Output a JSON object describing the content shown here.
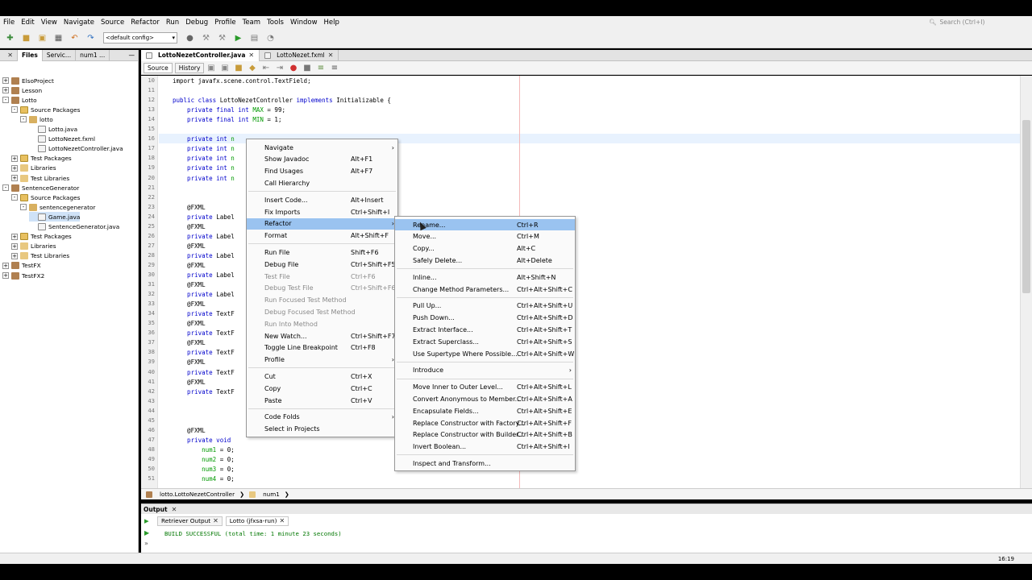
{
  "menubar": {
    "items": [
      "File",
      "Edit",
      "View",
      "Navigate",
      "Source",
      "Refactor",
      "Run",
      "Debug",
      "Profile",
      "Team",
      "Tools",
      "Window",
      "Help"
    ],
    "search_placeholder": "Search (Ctrl+I)"
  },
  "toolbar": {
    "config": "<default config>"
  },
  "left_panel": {
    "tabs": [
      "Files",
      "Servic...",
      "num1 ..."
    ],
    "tree": [
      {
        "label": "ElsoProject",
        "icon": "project-icon",
        "level": 0,
        "toggle": "+"
      },
      {
        "label": "Lesson",
        "icon": "project-icon",
        "level": 0,
        "toggle": "+"
      },
      {
        "label": "Lotto",
        "icon": "project-icon",
        "level": 0,
        "toggle": "-"
      },
      {
        "label": "Source Packages",
        "icon": "source-packages-icon",
        "level": 1,
        "toggle": "-"
      },
      {
        "label": "lotto",
        "icon": "package-icon",
        "level": 2,
        "toggle": "-"
      },
      {
        "label": "Lotto.java",
        "icon": "java-file-icon",
        "level": 3,
        "toggle": ""
      },
      {
        "label": "LottoNezet.fxml",
        "icon": "fxml-file-icon",
        "level": 3,
        "toggle": ""
      },
      {
        "label": "LottoNezetController.java",
        "icon": "java-file-icon",
        "level": 3,
        "toggle": ""
      },
      {
        "label": "Test Packages",
        "icon": "test-packages-icon",
        "level": 1,
        "toggle": "+"
      },
      {
        "label": "Libraries",
        "icon": "libraries-icon",
        "level": 1,
        "toggle": "+"
      },
      {
        "label": "Test Libraries",
        "icon": "libraries-icon",
        "level": 1,
        "toggle": "+"
      },
      {
        "label": "SentenceGenerator",
        "icon": "project-icon",
        "level": 0,
        "toggle": "-"
      },
      {
        "label": "Source Packages",
        "icon": "source-packages-icon",
        "level": 1,
        "toggle": "-"
      },
      {
        "label": "sentencegenerator",
        "icon": "package-icon",
        "level": 2,
        "toggle": "-"
      },
      {
        "label": "Game.java",
        "icon": "java-file-icon",
        "level": 3,
        "toggle": "",
        "selected": true
      },
      {
        "label": "SentenceGenerator.java",
        "icon": "java-file-icon",
        "level": 3,
        "toggle": ""
      },
      {
        "label": "Test Packages",
        "icon": "test-packages-icon",
        "level": 1,
        "toggle": "+"
      },
      {
        "label": "Libraries",
        "icon": "libraries-icon",
        "level": 1,
        "toggle": "+"
      },
      {
        "label": "Test Libraries",
        "icon": "libraries-icon",
        "level": 1,
        "toggle": "+"
      },
      {
        "label": "TestFX",
        "icon": "project-icon",
        "level": 0,
        "toggle": "+"
      },
      {
        "label": "TestFX2",
        "icon": "project-icon",
        "level": 0,
        "toggle": "+"
      }
    ]
  },
  "editor": {
    "tabs": [
      {
        "label": "LottoNezetController.java",
        "active": true
      },
      {
        "label": "LottoNezet.fxml",
        "active": false
      }
    ],
    "source_tab": "Source",
    "history_tab": "History",
    "lines": [
      {
        "n": "10",
        "parts": [
          [
            "import javafx.scene.control.TextField;",
            ""
          ]
        ]
      },
      {
        "n": "11",
        "parts": [
          [
            "",
            ""
          ]
        ]
      },
      {
        "n": "12",
        "parts": [
          [
            "public class ",
            "kw"
          ],
          [
            "LottoNezetController ",
            ""
          ],
          [
            "implements ",
            "kw"
          ],
          [
            "Initializable {",
            ""
          ]
        ]
      },
      {
        "n": "13",
        "parts": [
          [
            "    private final int ",
            "kw"
          ],
          [
            "MAX",
            "fld"
          ],
          [
            " = 99;",
            ""
          ]
        ]
      },
      {
        "n": "14",
        "parts": [
          [
            "    private final int ",
            "kw"
          ],
          [
            "MIN",
            "fld"
          ],
          [
            " = 1;",
            ""
          ]
        ]
      },
      {
        "n": "15",
        "parts": [
          [
            "",
            ""
          ]
        ]
      },
      {
        "n": "16",
        "parts": [
          [
            "    private int ",
            "kw"
          ],
          [
            "n",
            "fld"
          ]
        ]
      },
      {
        "n": "17",
        "parts": [
          [
            "    private int ",
            "kw"
          ],
          [
            "n",
            "fld"
          ]
        ]
      },
      {
        "n": "18",
        "parts": [
          [
            "    private int ",
            "kw"
          ],
          [
            "n",
            "fld"
          ]
        ]
      },
      {
        "n": "19",
        "parts": [
          [
            "    private int ",
            "kw"
          ],
          [
            "n",
            "fld"
          ]
        ]
      },
      {
        "n": "20",
        "parts": [
          [
            "    private int ",
            "kw"
          ],
          [
            "n",
            "fld"
          ]
        ]
      },
      {
        "n": "21",
        "parts": [
          [
            "",
            ""
          ]
        ]
      },
      {
        "n": "22",
        "parts": [
          [
            "",
            ""
          ]
        ]
      },
      {
        "n": "23",
        "parts": [
          [
            "    @FXML",
            ""
          ]
        ]
      },
      {
        "n": "24",
        "parts": [
          [
            "    private ",
            "kw"
          ],
          [
            "Label",
            ""
          ]
        ]
      },
      {
        "n": "25",
        "parts": [
          [
            "    @FXML",
            ""
          ]
        ]
      },
      {
        "n": "26",
        "parts": [
          [
            "    private ",
            "kw"
          ],
          [
            "Label",
            ""
          ]
        ]
      },
      {
        "n": "27",
        "parts": [
          [
            "    @FXML",
            ""
          ]
        ]
      },
      {
        "n": "28",
        "parts": [
          [
            "    private ",
            "kw"
          ],
          [
            "Label",
            ""
          ]
        ]
      },
      {
        "n": "29",
        "parts": [
          [
            "    @FXML",
            ""
          ]
        ]
      },
      {
        "n": "30",
        "parts": [
          [
            "    private ",
            "kw"
          ],
          [
            "Label",
            ""
          ]
        ]
      },
      {
        "n": "31",
        "parts": [
          [
            "    @FXML",
            ""
          ]
        ]
      },
      {
        "n": "32",
        "parts": [
          [
            "    private ",
            "kw"
          ],
          [
            "Label",
            ""
          ]
        ]
      },
      {
        "n": "33",
        "parts": [
          [
            "    @FXML",
            ""
          ]
        ]
      },
      {
        "n": "34",
        "parts": [
          [
            "    private ",
            "kw"
          ],
          [
            "TextF",
            ""
          ]
        ]
      },
      {
        "n": "35",
        "parts": [
          [
            "    @FXML",
            ""
          ]
        ]
      },
      {
        "n": "36",
        "parts": [
          [
            "    private ",
            "kw"
          ],
          [
            "TextF",
            ""
          ]
        ]
      },
      {
        "n": "37",
        "parts": [
          [
            "    @FXML",
            ""
          ]
        ]
      },
      {
        "n": "38",
        "parts": [
          [
            "    private ",
            "kw"
          ],
          [
            "TextF",
            ""
          ]
        ]
      },
      {
        "n": "39",
        "parts": [
          [
            "    @FXML",
            ""
          ]
        ]
      },
      {
        "n": "40",
        "parts": [
          [
            "    private ",
            "kw"
          ],
          [
            "TextF",
            ""
          ]
        ]
      },
      {
        "n": "41",
        "parts": [
          [
            "    @FXML",
            ""
          ]
        ]
      },
      {
        "n": "42",
        "parts": [
          [
            "    private ",
            "kw"
          ],
          [
            "TextF",
            ""
          ]
        ]
      },
      {
        "n": "43",
        "parts": [
          [
            "",
            ""
          ]
        ]
      },
      {
        "n": "44",
        "parts": [
          [
            "",
            ""
          ]
        ]
      },
      {
        "n": "45",
        "parts": [
          [
            "",
            ""
          ]
        ]
      },
      {
        "n": "46",
        "parts": [
          [
            "    @FXML",
            ""
          ]
        ]
      },
      {
        "n": "47",
        "parts": [
          [
            "    private void ",
            "kw"
          ]
        ]
      },
      {
        "n": "48",
        "parts": [
          [
            "        ",
            ""
          ],
          [
            "num1",
            "fld"
          ],
          [
            " = 0;",
            ""
          ]
        ]
      },
      {
        "n": "49",
        "parts": [
          [
            "        ",
            ""
          ],
          [
            "num2",
            "fld"
          ],
          [
            " = 0;",
            ""
          ]
        ]
      },
      {
        "n": "50",
        "parts": [
          [
            "        ",
            ""
          ],
          [
            "num3",
            "fld"
          ],
          [
            " = 0;",
            ""
          ]
        ]
      },
      {
        "n": "51",
        "parts": [
          [
            "        ",
            ""
          ],
          [
            "num4",
            "fld"
          ],
          [
            " = 0;",
            ""
          ]
        ]
      }
    ]
  },
  "navbar": {
    "class_crumb": "lotto.LottoNezetController",
    "field_crumb": "num1"
  },
  "context_menu": [
    {
      "label": "Navigate",
      "shortcut": "",
      "submenu": true
    },
    {
      "label": "Show Javadoc",
      "shortcut": "Alt+F1"
    },
    {
      "label": "Find Usages",
      "shortcut": "Alt+F7"
    },
    {
      "label": "Call Hierarchy",
      "shortcut": ""
    },
    {
      "sep": true
    },
    {
      "label": "Insert Code...",
      "shortcut": "Alt+Insert"
    },
    {
      "label": "Fix Imports",
      "shortcut": "Ctrl+Shift+I"
    },
    {
      "label": "Refactor",
      "shortcut": "",
      "submenu": true,
      "highlight": true
    },
    {
      "label": "Format",
      "shortcut": "Alt+Shift+F"
    },
    {
      "sep": true
    },
    {
      "label": "Run File",
      "shortcut": "Shift+F6"
    },
    {
      "label": "Debug File",
      "shortcut": "Ctrl+Shift+F5"
    },
    {
      "label": "Test File",
      "shortcut": "Ctrl+F6",
      "disabled": true
    },
    {
      "label": "Debug Test File",
      "shortcut": "Ctrl+Shift+F6",
      "disabled": true
    },
    {
      "label": "Run Focused Test Method",
      "shortcut": "",
      "disabled": true
    },
    {
      "label": "Debug Focused Test Method",
      "shortcut": "",
      "disabled": true
    },
    {
      "label": "Run Into Method",
      "shortcut": "",
      "disabled": true
    },
    {
      "label": "New Watch...",
      "shortcut": "Ctrl+Shift+F7"
    },
    {
      "label": "Toggle Line Breakpoint",
      "shortcut": "Ctrl+F8"
    },
    {
      "label": "Profile",
      "shortcut": "",
      "submenu": true
    },
    {
      "sep": true
    },
    {
      "label": "Cut",
      "shortcut": "Ctrl+X"
    },
    {
      "label": "Copy",
      "shortcut": "Ctrl+C"
    },
    {
      "label": "Paste",
      "shortcut": "Ctrl+V"
    },
    {
      "sep": true
    },
    {
      "label": "Code Folds",
      "shortcut": "",
      "submenu": true
    },
    {
      "label": "Select in Projects",
      "shortcut": ""
    }
  ],
  "refactor_submenu": [
    {
      "label": "Rename...",
      "shortcut": "Ctrl+R",
      "highlight": true
    },
    {
      "label": "Move...",
      "shortcut": "Ctrl+M"
    },
    {
      "label": "Copy...",
      "shortcut": "Alt+C"
    },
    {
      "label": "Safely Delete...",
      "shortcut": "Alt+Delete"
    },
    {
      "sep": true
    },
    {
      "label": "Inline...",
      "shortcut": "Alt+Shift+N"
    },
    {
      "label": "Change Method Parameters...",
      "shortcut": "Ctrl+Alt+Shift+C"
    },
    {
      "sep": true
    },
    {
      "label": "Pull Up...",
      "shortcut": "Ctrl+Alt+Shift+U"
    },
    {
      "label": "Push Down...",
      "shortcut": "Ctrl+Alt+Shift+D"
    },
    {
      "label": "Extract Interface...",
      "shortcut": "Ctrl+Alt+Shift+T"
    },
    {
      "label": "Extract Superclass...",
      "shortcut": "Ctrl+Alt+Shift+S"
    },
    {
      "label": "Use Supertype Where Possible...",
      "shortcut": "Ctrl+Alt+Shift+W"
    },
    {
      "sep": true
    },
    {
      "label": "Introduce",
      "shortcut": "",
      "submenu": true
    },
    {
      "sep": true
    },
    {
      "label": "Move Inner to Outer Level...",
      "shortcut": "Ctrl+Alt+Shift+L"
    },
    {
      "label": "Convert Anonymous to Member...",
      "shortcut": "Ctrl+Alt+Shift+A"
    },
    {
      "label": "Encapsulate Fields...",
      "shortcut": "Ctrl+Alt+Shift+E"
    },
    {
      "label": "Replace Constructor with Factory...",
      "shortcut": "Ctrl+Alt+Shift+F"
    },
    {
      "label": "Replace Constructor with Builder...",
      "shortcut": "Ctrl+Alt+Shift+B"
    },
    {
      "label": "Invert Boolean...",
      "shortcut": "Ctrl+Alt+Shift+I"
    },
    {
      "sep": true
    },
    {
      "label": "Inspect and Transform...",
      "shortcut": ""
    }
  ],
  "output": {
    "title": "Output",
    "tabs": [
      "Retriever Output",
      "Lotto (jfxsa-run)"
    ],
    "text": "BUILD SUCCESSFUL (total time: 1 minute 23 seconds)"
  },
  "status": {
    "position": "16:19"
  },
  "colors": {
    "highlight": "#9ac3f0",
    "keyword": "#0000cc",
    "field": "#009900",
    "build_success": "#007700"
  }
}
